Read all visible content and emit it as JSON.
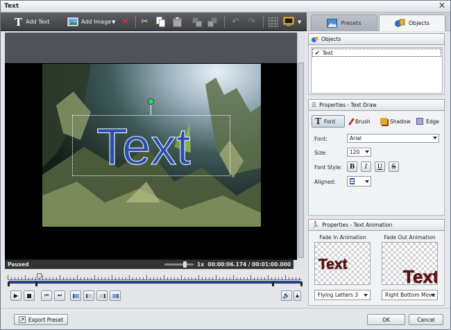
{
  "window": {
    "title": "Text"
  },
  "toolbar": {
    "add_text": "Add Text",
    "add_image": "Add Image"
  },
  "tabs": {
    "presets": "Presets",
    "objects": "Objects"
  },
  "objects_panel": {
    "header": "Objects",
    "items": [
      {
        "label": "Text",
        "checked": true
      }
    ]
  },
  "text_draw": {
    "header": "Properties - Text Draw",
    "tabs": [
      "Font",
      "Brush",
      "Shadow",
      "Edge"
    ],
    "font_label": "Font:",
    "font_value": "Arial",
    "size_label": "Size:",
    "size_value": "120",
    "style_label": "Font Style:",
    "style_buttons": [
      "B",
      "I",
      "U",
      "S"
    ],
    "aligned_label": "Aligned:"
  },
  "text_animation": {
    "header": "Properties - Text Animation",
    "fade_in_label": "Fade In Animation",
    "fade_in_value": "Flying Letters 3",
    "fade_out_label": "Fade Out Animation",
    "fade_out_value": "Right Bottom Move",
    "preview_text": "Text"
  },
  "preview": {
    "overlay_text": "Text"
  },
  "status": {
    "state": "Paused",
    "zoom": "1x",
    "timecode": "00:00:06.174 / 00:01:00.000"
  },
  "footer": {
    "export_preset": "Export Preset",
    "ok": "OK",
    "cancel": "Cancel"
  },
  "colors": {
    "accent": "#2f5bb7",
    "text_blue": "#2a4fa8",
    "anim_red": "#6a0d12"
  }
}
